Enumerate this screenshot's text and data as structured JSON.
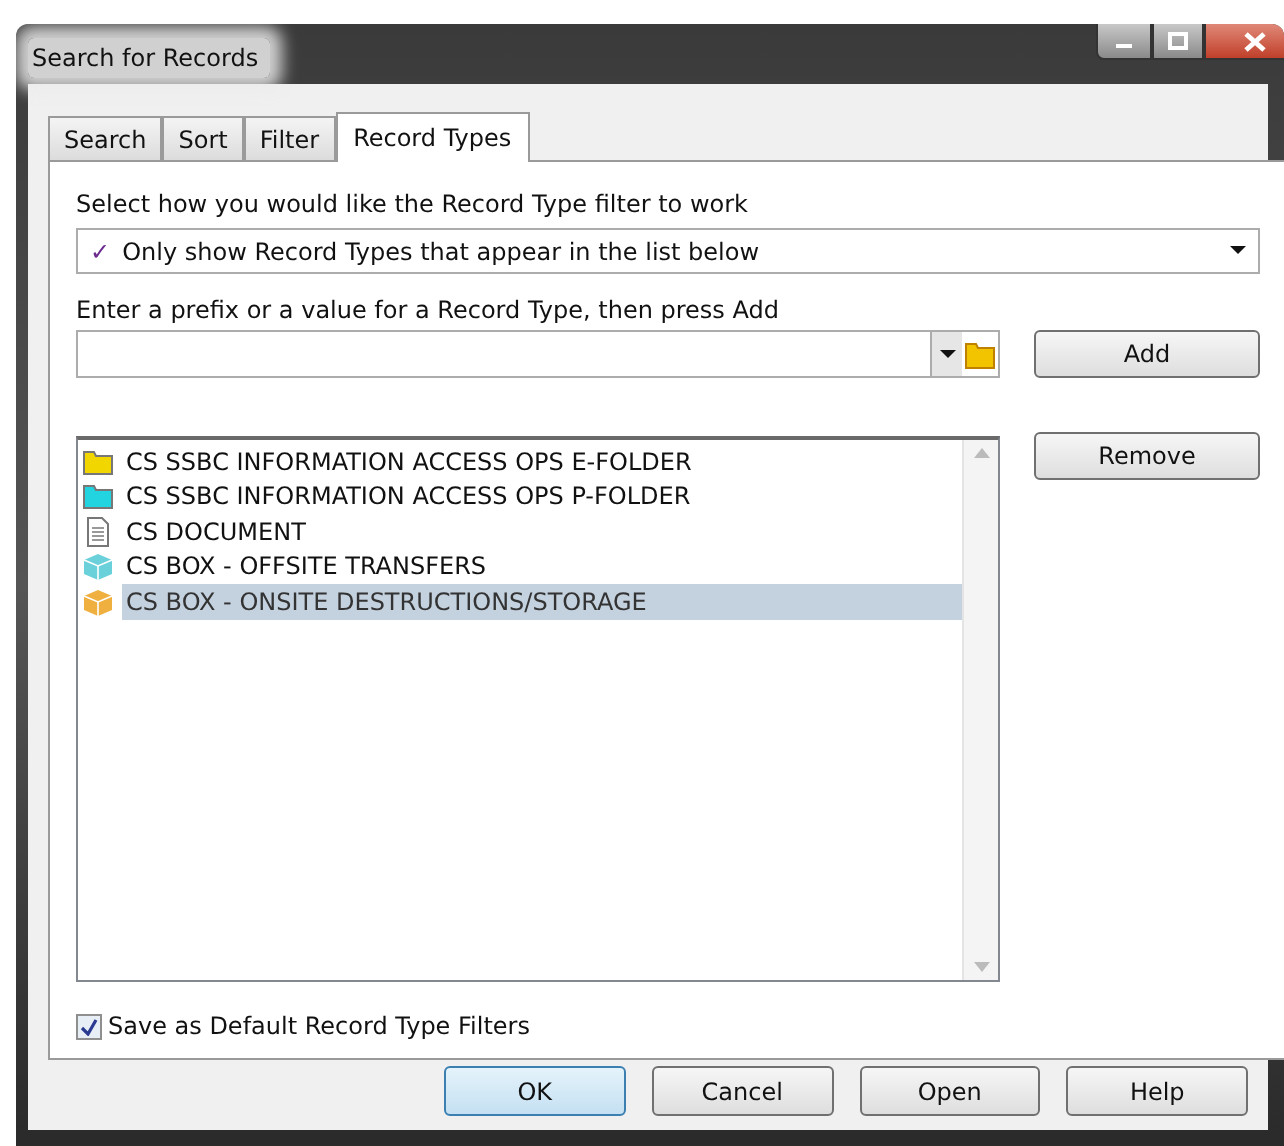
{
  "window": {
    "title": "Search for Records"
  },
  "tabs": [
    {
      "label": "Search",
      "selected": false
    },
    {
      "label": "Sort",
      "selected": false
    },
    {
      "label": "Filter",
      "selected": false
    },
    {
      "label": "Record Types",
      "selected": true
    }
  ],
  "mode_label": "Select how you would like the Record Type filter to work",
  "mode_select": {
    "mark": "✓",
    "value": "Only show Record Types that appear in the list below"
  },
  "prefix_label": "Enter a prefix or a value for a Record Type, then press Add",
  "add_button": "Add",
  "remove_button": "Remove",
  "record_types": [
    {
      "kind": "folder",
      "color": "#f2d600",
      "label": "CS SSBC INFORMATION ACCESS OPS E-FOLDER",
      "selected": false
    },
    {
      "kind": "folder",
      "color": "#22d3e0",
      "label": "CS SSBC INFORMATION ACCESS OPS P-FOLDER",
      "selected": false
    },
    {
      "kind": "document",
      "label": "CS DOCUMENT",
      "selected": false
    },
    {
      "kind": "box",
      "color": "#6ad0da",
      "label": "CS BOX - OFFSITE TRANSFERS",
      "selected": false
    },
    {
      "kind": "box",
      "color": "#f0b040",
      "label": "CS BOX - ONSITE DESTRUCTIONS/STORAGE",
      "selected": true
    }
  ],
  "save_default": {
    "label": "Save as Default Record Type Filters",
    "checked": true
  },
  "buttons": [
    {
      "label": "OK",
      "default": true
    },
    {
      "label": "Cancel",
      "default": false
    },
    {
      "label": "Open",
      "default": false
    },
    {
      "label": "Help",
      "default": false
    }
  ]
}
